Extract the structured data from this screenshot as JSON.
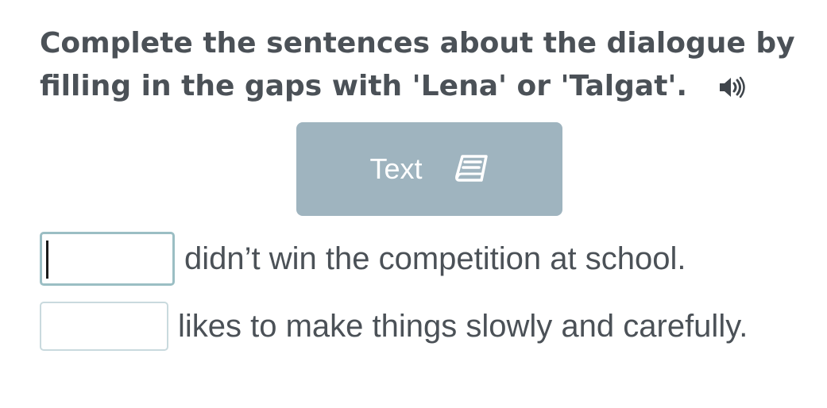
{
  "instruction": {
    "text": "Complete the sentences about the dialogue by filling in the gaps with 'Lena' or 'Talgat'.",
    "audio_icon": "speaker-icon"
  },
  "text_button": {
    "label": "Text",
    "icon": "book-icon"
  },
  "sentences": [
    {
      "value": "",
      "text": "didn’t win the competition at school."
    },
    {
      "value": "",
      "text": "likes to make things slowly and carefully."
    }
  ],
  "colors": {
    "heading": "#4b5157",
    "button_bg": "#9fb4bf",
    "input_border": "#c9dade",
    "input_active_border": "#9bbec4"
  }
}
